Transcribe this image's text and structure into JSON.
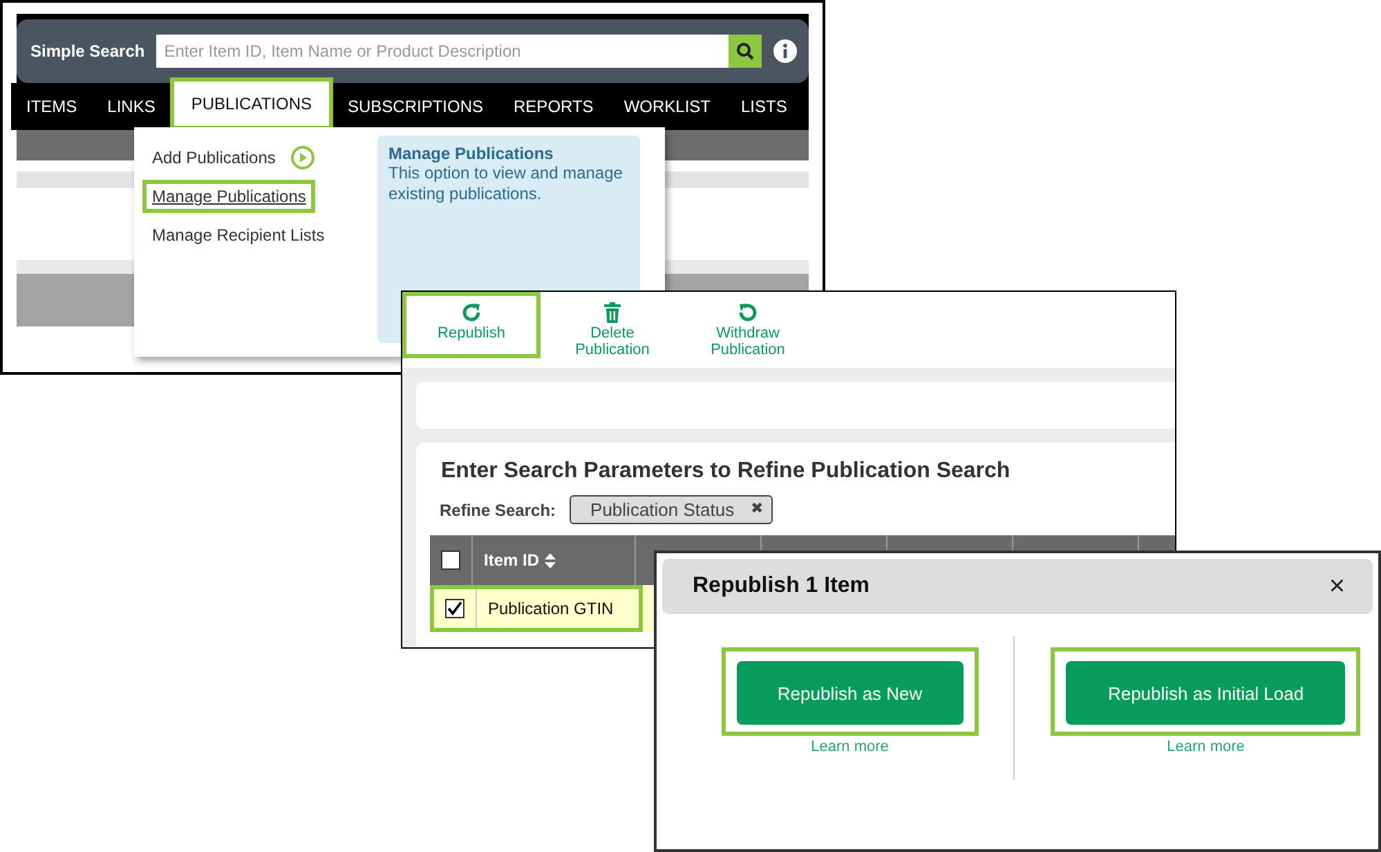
{
  "top_screen": {
    "search": {
      "label": "Simple Search",
      "placeholder": "Enter Item ID, Item Name or Product Description"
    },
    "tabs": [
      {
        "label": "ITEMS",
        "selected": false,
        "highlighted": false
      },
      {
        "label": "LINKS",
        "selected": false,
        "highlighted": false
      },
      {
        "label": "PUBLICATIONS",
        "selected": true,
        "highlighted": true
      },
      {
        "label": "SUBSCRIPTIONS",
        "selected": false,
        "highlighted": false
      },
      {
        "label": "REPORTS",
        "selected": false,
        "highlighted": false
      },
      {
        "label": "WORKLIST",
        "selected": false,
        "highlighted": false
      },
      {
        "label": "LISTS",
        "selected": false,
        "highlighted": false
      }
    ],
    "menu": {
      "items": [
        {
          "label": "Add Publications",
          "kind": "action",
          "highlighted": false
        },
        {
          "label": "Manage Publications",
          "kind": "link",
          "highlighted": true
        },
        {
          "label": "Manage Recipient Lists",
          "kind": "plain",
          "highlighted": false
        }
      ],
      "info": {
        "title": "Manage Publications",
        "text": "This option to view and manage existing publications."
      }
    }
  },
  "middle_screen": {
    "toolbar": [
      {
        "label": "Republish",
        "kind": "republish",
        "highlighted": true
      },
      {
        "label": "Delete Publication",
        "kind": "delete",
        "highlighted": false
      },
      {
        "label": "Withdraw Publication",
        "kind": "withdraw",
        "highlighted": false
      }
    ],
    "heading": "Enter Search Parameters to Refine Publication Search",
    "refine": {
      "label": "Refine Search:",
      "chip": "Publication Status",
      "chip_close": "✖"
    },
    "table": {
      "header_checked": false,
      "columns": [
        "Item ID"
      ],
      "rows": [
        {
          "checked": true,
          "highlighted": true,
          "cells": [
            "Publication GTIN"
          ]
        }
      ]
    }
  },
  "dialog": {
    "title": "Republish 1 Item",
    "close": "×",
    "options": [
      {
        "button": "Republish as New",
        "link": "Learn more",
        "highlighted": true
      },
      {
        "button": "Republish as Initial Load",
        "link": "Learn more",
        "highlighted": true
      }
    ]
  }
}
